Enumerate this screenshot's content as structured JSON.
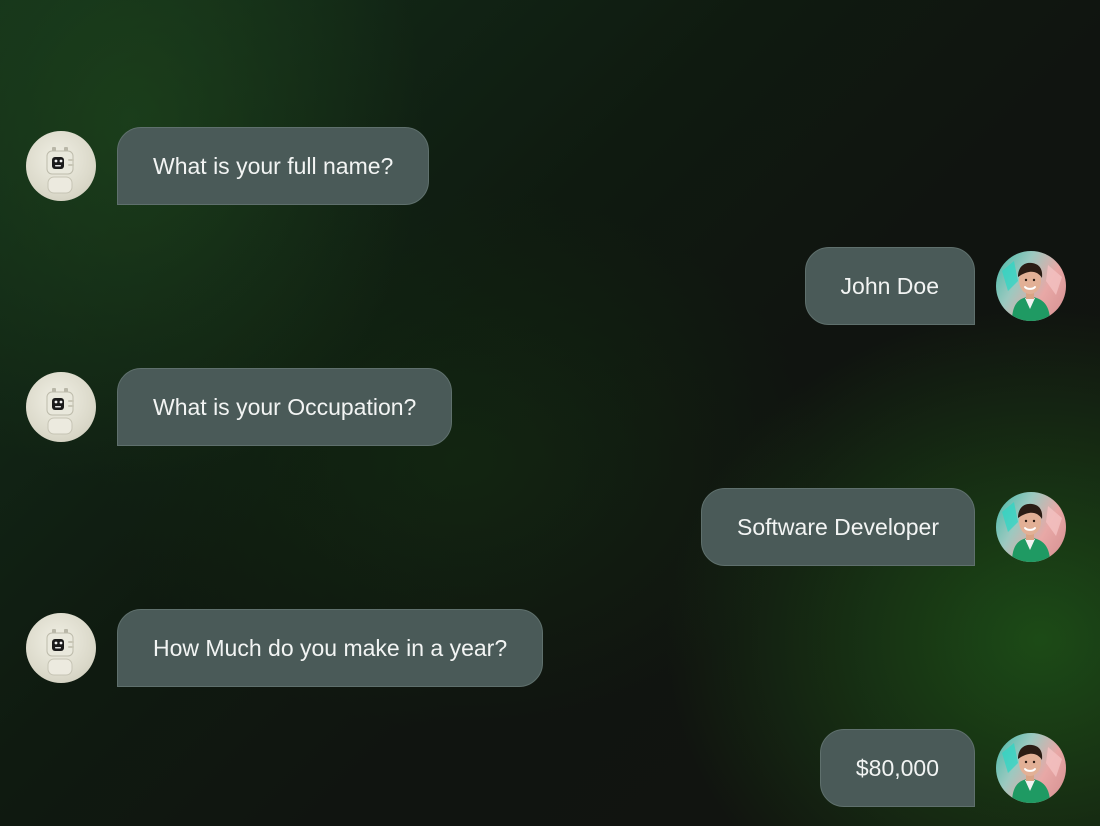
{
  "chat": {
    "messages": [
      {
        "sender": "bot",
        "text": "What is your full name?",
        "avatar_icon": "robot-avatar-icon"
      },
      {
        "sender": "user",
        "text": "John Doe",
        "avatar_icon": "user-avatar-photo"
      },
      {
        "sender": "bot",
        "text": "What is your Occupation?",
        "avatar_icon": "robot-avatar-icon"
      },
      {
        "sender": "user",
        "text": "Software Developer",
        "avatar_icon": "user-avatar-photo"
      },
      {
        "sender": "bot",
        "text": "How Much do you make in a year?",
        "avatar_icon": "robot-avatar-icon"
      },
      {
        "sender": "user",
        "text": "$80,000",
        "avatar_icon": "user-avatar-photo"
      }
    ]
  },
  "colors": {
    "bubble_bg": "#4a5a58",
    "bubble_text": "#f2f4f3",
    "background_dark": "#101410",
    "background_green": "#1e5418"
  }
}
